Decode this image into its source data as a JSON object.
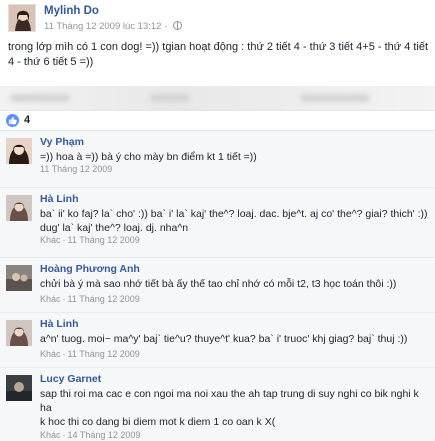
{
  "post": {
    "author": "Mylinh Do",
    "timestamp": "11 Tháng 12 2009 lúc 13:12 ·",
    "privacy_icon": "globe-icon",
    "text": "trong lớp mìh có 1 con dog! =)) tgian hoạt động : thứ 2 tiết 4 - thứ 3 tiết 4+5 - thứ 4 tiết 4 - thứ 6 tiết 5 =))"
  },
  "reactions": {
    "icon": "thumbs-up-icon",
    "count": "4",
    "color": "#5890ff"
  },
  "comments": [
    {
      "name": "Vy Phạm",
      "text": "=)) hoa à =)) bà ý cho mày bn điểm kt 1 tiết =))",
      "action": "",
      "date": "11 Tháng 12 2009"
    },
    {
      "name": "Hà Linh",
      "text": "ba` ii' ko faj? la` cho' :)) ba` i' la` kaj' the^? loaj. dac. bje^t. aj co' the^? giai? thich' :)) dug' la` kaj' the^? loaj. dj. nha^n",
      "action": "Khác",
      "date": "11 Tháng 12 2009"
    },
    {
      "name": "Hoàng Phương Anh",
      "text": "chửi bà ý mà sao nhớ tiết bà ấy thế tao chỉ nhớ có mỗi t2, t3 học toán thôi :))",
      "action": "Khác",
      "date": "11 Tháng 12 2009"
    },
    {
      "name": "Hà Linh",
      "text": "a^n' tuog. moi~ ma^y' baj` tie^u? thuye^t' kua? ba` i' truoc' khj giag? baj` thuj :))",
      "action": "Khác",
      "date": "11 Tháng 12 2009"
    },
    {
      "name": "Lucy Garnet",
      "text": "sap thi roi ma cac e con ngoi ma noi xau the ah tap trung di suy nghi co bik nghi k ha\nk hoc thi co dang bi diem mot k diem 1 co oan k X(",
      "action": "Khác",
      "date": "14 Tháng 12 2009"
    }
  ]
}
